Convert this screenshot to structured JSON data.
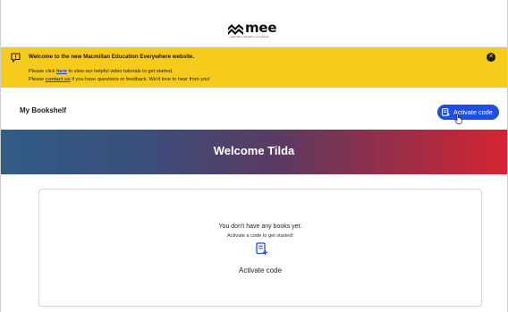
{
  "header": {
    "logo_text": "mee",
    "logo_subtitle": "macmillan education everywhere"
  },
  "banner": {
    "title": "Welcome to the new Macmillan Education Everywhere website.",
    "line1_prefix": "Please click ",
    "line1_link": "here",
    "line1_suffix": " to view our helpful video tutorials to get started.",
    "line2_prefix": "Please ",
    "line2_link": "contact us",
    "line2_suffix": " if you have questions or feedback. We'd love to hear from you!",
    "close_icon": "close-icon",
    "background_color": "#f7cb1c"
  },
  "bookshelf": {
    "title": "My Bookshelf",
    "activate_button_label": "Activate code",
    "accent_color": "#1f4fe0"
  },
  "welcome": {
    "text": "Welcome Tilda"
  },
  "empty_state": {
    "line1": "You don't have any books yet.",
    "line2": "Activate a code to get started!",
    "activate_label": "Activate code"
  }
}
